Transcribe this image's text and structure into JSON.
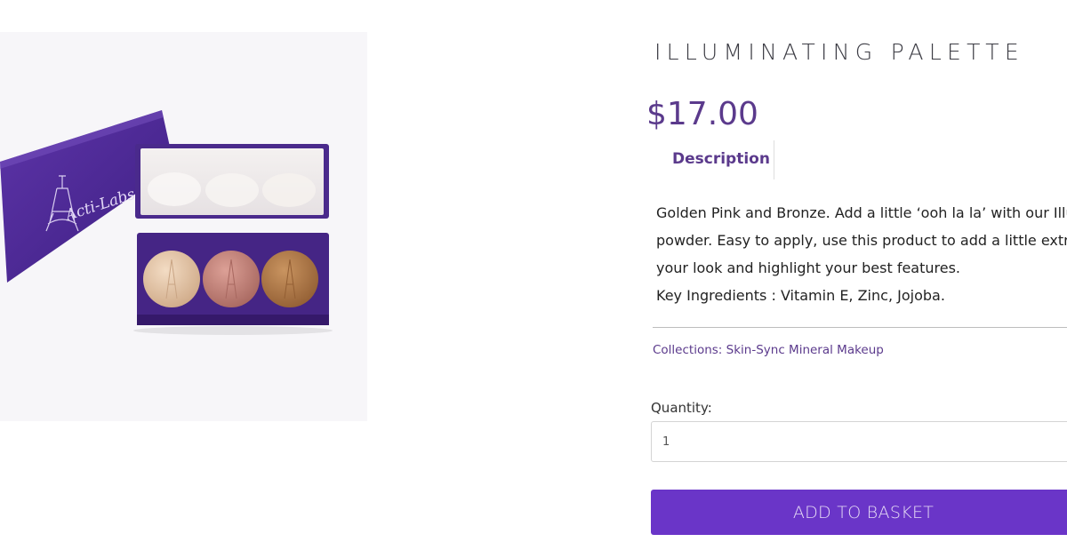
{
  "product": {
    "image_alt": "Illuminating Palette product photo",
    "brand_logo_text": "Acti-Labs",
    "title": "ILLUMINATING PALETTE",
    "price": "$17.00"
  },
  "tabs": {
    "description_label": "Description"
  },
  "description": {
    "lines": [
      "Golden Pink and Bronze. Add a little ‘ooh la la’ with our Illu",
      "powder. Easy to apply, use this product to add a little extr",
      "your look and highlight your best features.",
      "Key Ingredients : Vitamin E, Zinc, Jojoba."
    ]
  },
  "collections": {
    "label": "Collections:",
    "value": "Skin-Sync Mineral Makeup"
  },
  "quantity": {
    "label": "Quantity:",
    "value": "1"
  },
  "cta": {
    "add_label": "ADD TO BASKET"
  },
  "colors": {
    "accent": "#6a35c8",
    "price_text": "#5b3a8c",
    "palette_case": "#4a2a8c",
    "shade_golden": "#e2c3a6",
    "shade_pink": "#c48478",
    "shade_bronze": "#b17a48"
  }
}
